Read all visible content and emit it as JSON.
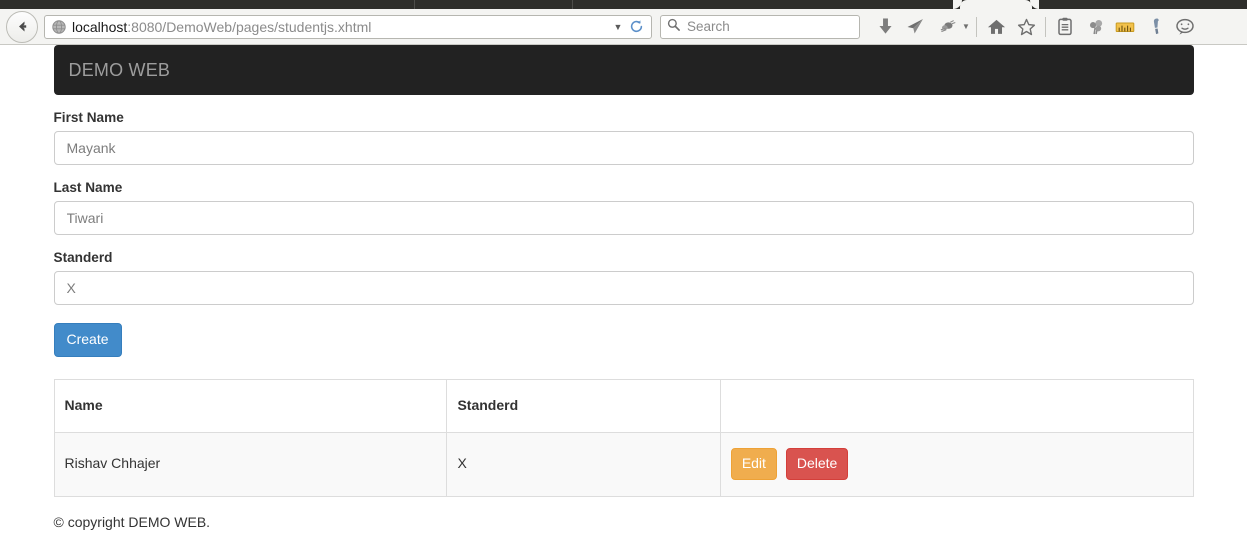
{
  "browser": {
    "back_label": "Back",
    "url_host": "localhost",
    "url_rest": ":8080/DemoWeb/pages/studentjs.xhtml",
    "url_dropdown_caret": "▼",
    "search_placeholder": "Search",
    "toolbar_icons": [
      {
        "name": "download-icon",
        "label": "Downloads"
      },
      {
        "name": "send-icon",
        "label": "Send"
      },
      {
        "name": "pocket-icon",
        "label": "Pocket"
      },
      {
        "name": "home-icon",
        "label": "Home"
      },
      {
        "name": "bookmark-star-icon",
        "label": "Bookmark"
      },
      {
        "name": "reading-list-icon",
        "label": "Reading List"
      },
      {
        "name": "palette-icon",
        "label": "Themes"
      },
      {
        "name": "ruler-icon",
        "label": "Measure"
      },
      {
        "name": "wrench-icon",
        "label": "Tools"
      },
      {
        "name": "chat-icon",
        "label": "Chat"
      }
    ]
  },
  "app": {
    "brand": "DEMO WEB",
    "form": {
      "first_name": {
        "label": "First Name",
        "value": "Mayank"
      },
      "last_name": {
        "label": "Last Name",
        "value": "Tiwari"
      },
      "standerd": {
        "label": "Standerd",
        "value": "X"
      }
    },
    "create_button": "Create",
    "table": {
      "headers": [
        "Name",
        "Standerd",
        ""
      ],
      "rows": [
        {
          "name": "Rishav Chhajer",
          "standerd": "X",
          "edit_label": "Edit",
          "delete_label": "Delete"
        }
      ]
    },
    "footer": "© copyright DEMO WEB."
  },
  "colors": {
    "navbar_bg": "#222222",
    "brand_text": "#9d9d9d",
    "primary": "#428bca",
    "warning": "#f0ad4e",
    "danger": "#d9534f",
    "table_border": "#dddddd",
    "row_bg": "#f9f9f9"
  }
}
